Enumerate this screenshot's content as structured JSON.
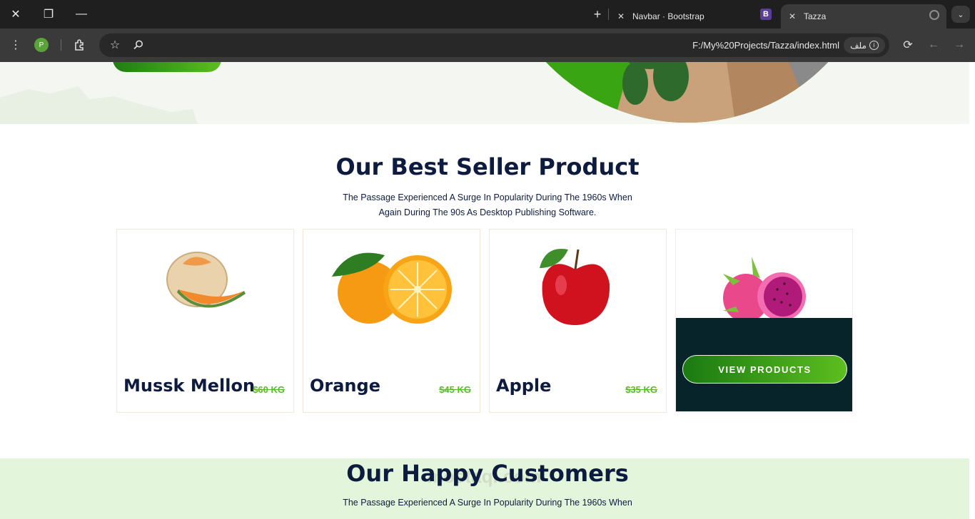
{
  "browser": {
    "tabs": [
      {
        "title": "Navbar · Bootstrap",
        "favicon": "B"
      },
      {
        "title": "Tazza",
        "active": true
      }
    ],
    "profile_initial": "P",
    "url": "F:/My%20Projects/Tazza/index.html",
    "site_chip_label": "ملف"
  },
  "bestseller": {
    "title": "Our Best Seller Product",
    "subtitle_line1": "The Passage Experienced A Surge In Popularity During The 1960s When",
    "subtitle_line2": "Again During The 90s As Desktop Publishing Software.",
    "products": [
      {
        "name": "Mussk Mellon",
        "price": "$60 KG"
      },
      {
        "name": "Orange",
        "price": "$45 KG"
      },
      {
        "name": "Apple",
        "price": "$35 KG"
      }
    ],
    "view_button": "VIEW PRODUCTS"
  },
  "customers": {
    "title": "Our Happy Customers",
    "subtitle_line1": "The Passage Experienced A Surge In Popularity During The 1960s When"
  },
  "watermark": "mostaql.com",
  "colors": {
    "accent_green": "#5cb82a",
    "navy": "#0d1b3e",
    "dark_teal": "#062429"
  }
}
